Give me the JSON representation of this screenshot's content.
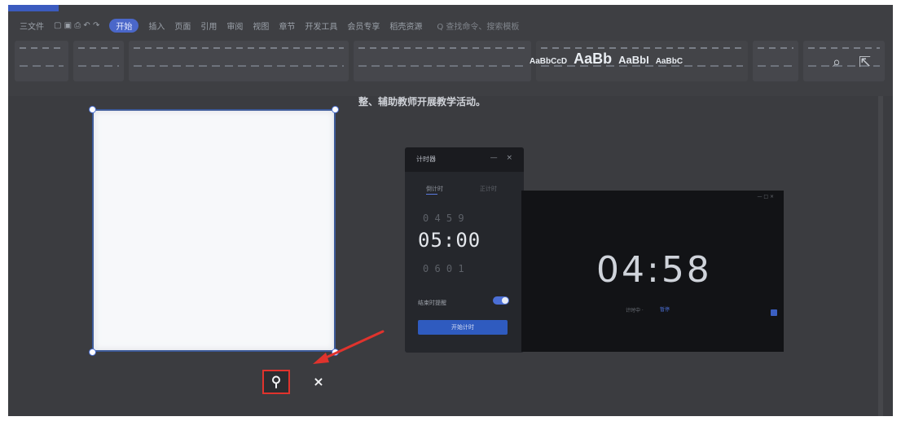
{
  "ribbon": {
    "tabs": [
      "三文件",
      "开始",
      "插入",
      "页面",
      "引用",
      "审阅",
      "视图",
      "章节",
      "开发工具",
      "会员专享",
      "稻壳资源"
    ],
    "active_tab": "开始",
    "search_hint": "Q 查找命令、搜索模板",
    "style_previews": [
      "AaBbCcD",
      "AaBb",
      "AaBbI",
      "AaBbC"
    ]
  },
  "document": {
    "text_line": "整、辅助教师开展教学活动。"
  },
  "timer_panel": {
    "title": "计时器",
    "controls": "— ×",
    "tabs": [
      "倒计时",
      "正计时"
    ],
    "ghost_top": "0 4   5 9",
    "set_time": "05:00",
    "ghost_bottom": "0 6   0 1",
    "option_label": "结束时提醒",
    "start_button": "开始计时"
  },
  "fullscreen": {
    "countdown": "04:58",
    "top_hint": "— □ ×",
    "hint_text": "计时中 · ",
    "hint_link": "暂停"
  },
  "floating_bar": {
    "pin_icon": "pin-icon",
    "close_glyph": "×"
  },
  "colors": {
    "accent": "#3b5bbf",
    "highlight_border": "#e0332d",
    "arrow": "#e0332d"
  }
}
